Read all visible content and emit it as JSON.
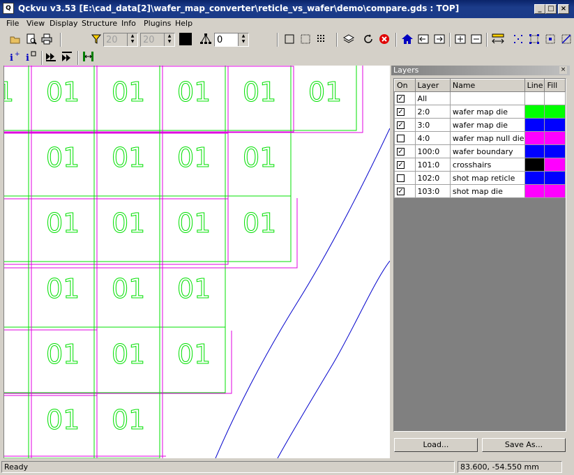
{
  "window": {
    "title": "Qckvu v3.53 [E:\\cad_data[2]\\wafer_map_converter\\reticle_vs_wafer\\demo\\compare.gds : TOP]",
    "app_icon": "Q"
  },
  "menu": [
    "File",
    "View",
    "Display",
    "Structure",
    "Info",
    "Plugins",
    "Help"
  ],
  "toolbar": {
    "spin1_value": "20",
    "spin2_value": "20",
    "depth_value": "0",
    "icons": [
      "open-folder-icon",
      "print-preview-icon",
      "print-icon",
      "filter-icon",
      "color-swatch-icon",
      "hierarchy-icon",
      "outline-box-icon",
      "dotted-box-icon",
      "grid-box-icon",
      "layers-icon",
      "refresh-icon",
      "stop-icon",
      "home-icon",
      "pan-left-icon",
      "pan-right-icon",
      "zoom-in-icon",
      "zoom-out-icon",
      "measure-icon",
      "select-points-icon",
      "select-box-icon",
      "select-diagonal-icon"
    ],
    "row2_icons": [
      "info-add-icon",
      "info-box-icon",
      "step-forward-icon",
      "step-end-icon",
      "ruler-icon"
    ]
  },
  "canvas": {
    "die_label": "01"
  },
  "layers_panel": {
    "title": "Layers",
    "columns": [
      "On",
      "Layer",
      "Name",
      "Line",
      "Fill"
    ],
    "rows": [
      {
        "on": true,
        "layer": "All",
        "name": "",
        "line": "",
        "fill": ""
      },
      {
        "on": true,
        "layer": "2:0",
        "name": "wafer map die",
        "line": "#00ff00",
        "fill": "#00ff00"
      },
      {
        "on": true,
        "layer": "3:0",
        "name": "wafer map die",
        "line": "#0000ff",
        "fill": "#0000ff"
      },
      {
        "on": false,
        "layer": "4:0",
        "name": "wafer map null die",
        "line": "#ff00ff",
        "fill": "#ff00ff"
      },
      {
        "on": true,
        "layer": "100:0",
        "name": "wafer boundary",
        "line": "#0000ff",
        "fill": "#0000ff"
      },
      {
        "on": true,
        "layer": "101:0",
        "name": "crosshairs",
        "line": "#000000",
        "fill": "#ff00ff"
      },
      {
        "on": false,
        "layer": "102:0",
        "name": "shot map reticle",
        "line": "#0000ff",
        "fill": "#0000ff"
      },
      {
        "on": true,
        "layer": "103:0",
        "name": "shot map die",
        "line": "#ff00ff",
        "fill": "#ff00ff"
      }
    ],
    "load_label": "Load...",
    "save_label": "Save As..."
  },
  "status": {
    "left": "Ready",
    "coords": "83.600, -54.550 mm"
  },
  "colors": {
    "die_green": "#00e000",
    "shot_magenta": "#e000e0",
    "boundary_blue": "#0000cc"
  }
}
